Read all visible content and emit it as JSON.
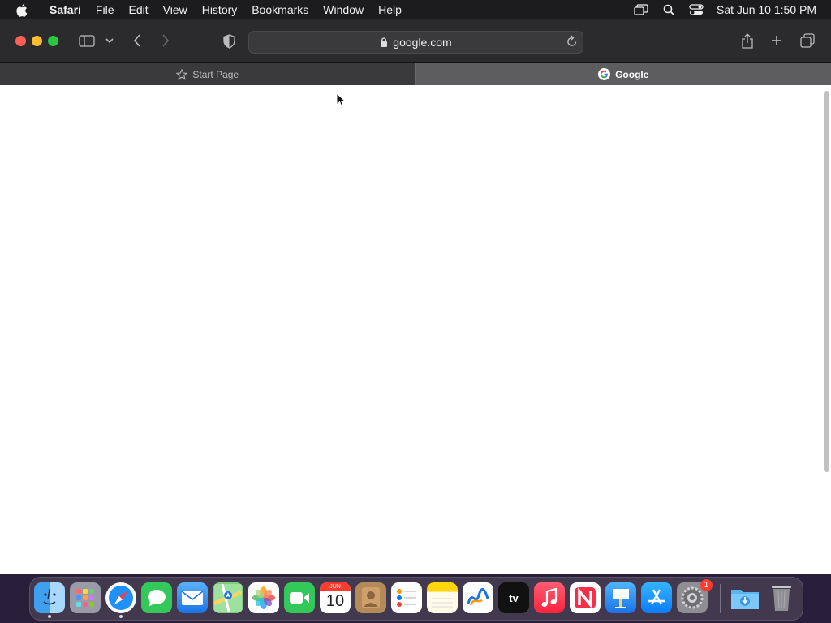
{
  "menubar": {
    "app_name": "Safari",
    "items": [
      "File",
      "Edit",
      "View",
      "History",
      "Bookmarks",
      "Window",
      "Help"
    ],
    "clock": "Sat Jun 10  1:50 PM"
  },
  "toolbar": {
    "url": "google.com"
  },
  "tabs": [
    {
      "label": "Start Page",
      "icon": "star-icon",
      "active": false
    },
    {
      "label": "Google",
      "icon": "google-icon",
      "active": true
    }
  ],
  "dock": {
    "apps": [
      {
        "name": "Finder",
        "icon": "finder-icon",
        "running": true
      },
      {
        "name": "Launchpad",
        "icon": "launchpad-icon",
        "running": false
      },
      {
        "name": "Safari",
        "icon": "safari-icon",
        "running": true
      },
      {
        "name": "Messages",
        "icon": "messages-icon",
        "running": false
      },
      {
        "name": "Mail",
        "icon": "mail-icon",
        "running": false
      },
      {
        "name": "Maps",
        "icon": "maps-icon",
        "running": false
      },
      {
        "name": "Photos",
        "icon": "photos-icon",
        "running": false
      },
      {
        "name": "FaceTime",
        "icon": "facetime-icon",
        "running": false
      },
      {
        "name": "Calendar",
        "icon": "calendar-icon",
        "running": false
      },
      {
        "name": "Contacts",
        "icon": "contacts-icon",
        "running": false
      },
      {
        "name": "Reminders",
        "icon": "reminders-icon",
        "running": false
      },
      {
        "name": "Notes",
        "icon": "notes-icon",
        "running": false
      },
      {
        "name": "Freeform",
        "icon": "freeform-icon",
        "running": false
      },
      {
        "name": "TV",
        "icon": "tv-icon",
        "running": false
      },
      {
        "name": "Music",
        "icon": "music-icon",
        "running": false
      },
      {
        "name": "News",
        "icon": "news-icon",
        "running": false
      },
      {
        "name": "Keynote",
        "icon": "keynote-icon",
        "running": false
      },
      {
        "name": "App Store",
        "icon": "app-store-icon",
        "running": false
      },
      {
        "name": "System Settings",
        "icon": "settings-icon",
        "running": false,
        "badge": "1"
      }
    ],
    "calendar_month": "JUN",
    "calendar_day": "10",
    "tv_label": "tv",
    "settings_badge": "1"
  },
  "colors": {
    "menubar_bg": "#1c1c1e",
    "toolbar_bg": "#2b2b2d",
    "active_tab_bg": "#5d5d60",
    "close": "#ff5f57",
    "minimize": "#febc2e",
    "maximize": "#28c840"
  }
}
